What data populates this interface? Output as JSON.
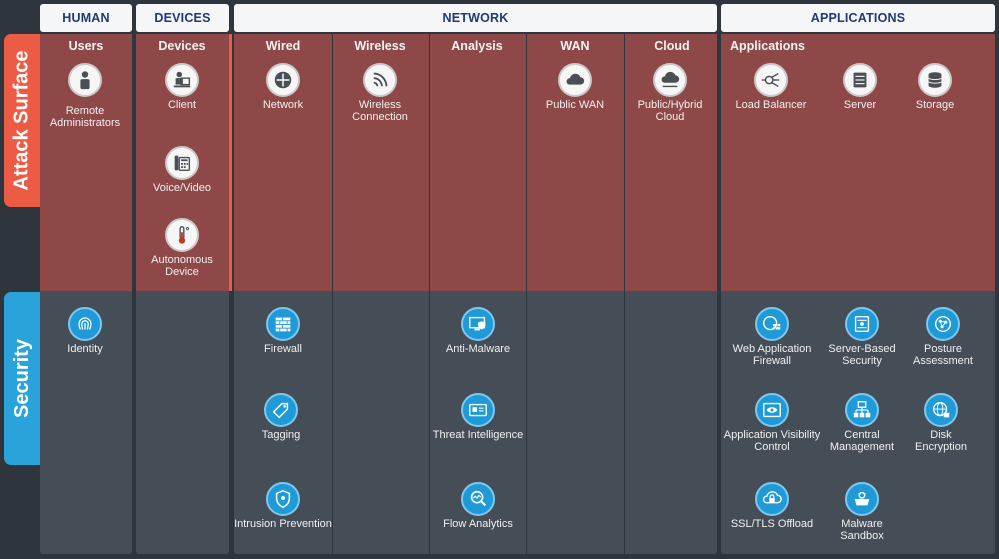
{
  "headers": {
    "human": "HUMAN",
    "devices": "DEVICES",
    "network": "NETWORK",
    "applications": "APPLICATIONS"
  },
  "side_labels": {
    "attack_surface": "Attack Surface",
    "security": "Security"
  },
  "columns": {
    "users": "Users",
    "devices": "Devices",
    "wired": "Wired",
    "wireless": "Wireless",
    "analysis": "Analysis",
    "wan": "WAN",
    "cloud": "Cloud",
    "applications": "Applications"
  },
  "attack_surface_items": {
    "remote_admins": "Remote\nAdministrators",
    "client": "Client",
    "voice_video": "Voice/Video",
    "autonomous_device": "Autonomous\nDevice",
    "network": "Network",
    "wireless_connection": "Wireless\nConnection",
    "public_wan": "Public WAN",
    "public_hybrid_cloud": "Public/Hybrid\nCloud",
    "load_balancer": "Load Balancer",
    "server": "Server",
    "storage": "Storage"
  },
  "security_items": {
    "identity": "Identity",
    "firewall": "Firewall",
    "tagging": "Tagging",
    "intrusion_prevention": "Intrusion Prevention",
    "anti_malware": "Anti-Malware",
    "threat_intelligence": "Threat Intelligence",
    "flow_analytics": "Flow Analytics",
    "waf": "Web Application\nFirewall",
    "server_based_security": "Server-Based\nSecurity",
    "posture_assessment": "Posture\nAssessment",
    "app_visibility_control": "Application Visibility\nControl",
    "central_management": "Central\nManagement",
    "disk_encryption": "Disk\nEncryption",
    "ssl_tls_offload": "SSL/TLS Offload",
    "malware_sandbox": "Malware\nSandbox"
  },
  "colors": {
    "attack_accent": "#ec5c44",
    "attack_fill": "#8f4848",
    "security_accent": "#2aa3db",
    "security_fill": "#454d56",
    "header_text": "#1f3a74",
    "background": "#2f353c"
  }
}
